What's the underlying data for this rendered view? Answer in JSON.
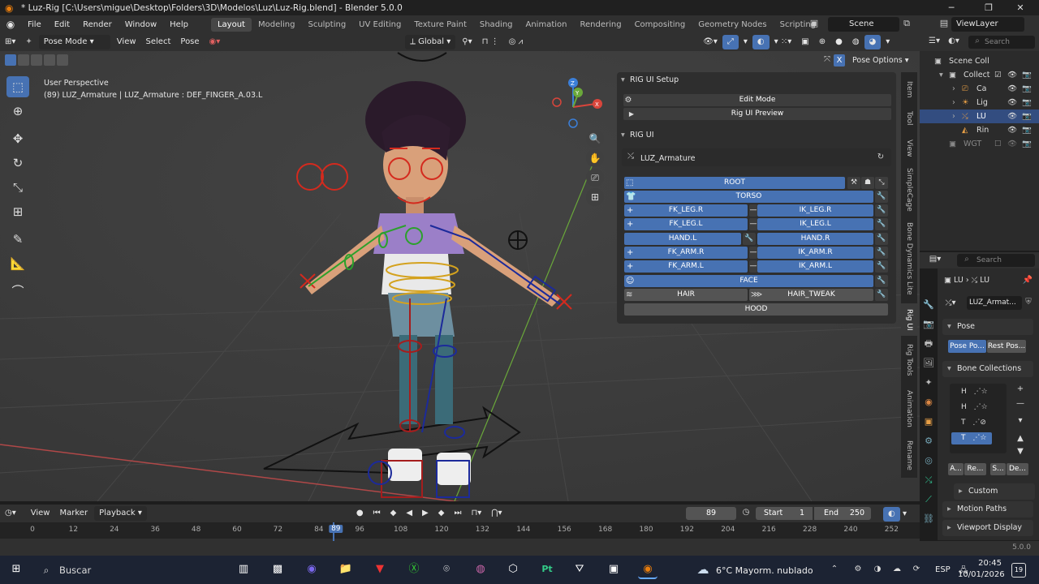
{
  "window": {
    "title": "* Luz-Rig [C:\\Users\\migue\\Desktop\\Folders\\3D\\Modelos\\Luz\\Luz-Rig.blend] - Blender 5.0.0",
    "minimize": "─",
    "maximize": "❐",
    "close": "✕"
  },
  "menu": {
    "items": [
      "File",
      "Edit",
      "Render",
      "Window",
      "Help"
    ]
  },
  "workspaces": [
    "Layout",
    "Modeling",
    "Sculpting",
    "UV Editing",
    "Texture Paint",
    "Shading",
    "Animation",
    "Rendering",
    "Compositing",
    "Geometry Nodes",
    "Scripting"
  ],
  "scene": {
    "label": "Scene",
    "view_layer": "ViewLayer"
  },
  "viewport_header": {
    "mode": "Pose Mode",
    "menus": [
      "View",
      "Select",
      "Pose"
    ],
    "orientation": "Global",
    "pose_options": "Pose Options"
  },
  "viewport": {
    "perspective": "User Perspective",
    "info": "(89) LUZ_Armature | LUZ_Armature : DEF_FINGER_A.03.L"
  },
  "gizmo": {
    "z": "Z",
    "y": "Y",
    "x": "X"
  },
  "rig_setup": {
    "title": "RIG UI Setup",
    "edit_mode": "Edit Mode",
    "preview": "Rig UI Preview"
  },
  "rig_ui": {
    "title": "RIG UI",
    "armature": "LUZ_Armature",
    "root": "ROOT",
    "torso": "TORSO",
    "fk_leg_r": "FK_LEG.R",
    "ik_leg_r": "IK_LEG.R",
    "fk_leg_l": "FK_LEG.L",
    "ik_leg_l": "IK_LEG.L",
    "hand_l": "HAND.L",
    "hand_r": "HAND.R",
    "fk_arm_r": "FK_ARM.R",
    "ik_arm_r": "IK_ARM.R",
    "fk_arm_l": "FK_ARM.L",
    "ik_arm_l": "IK_ARM.L",
    "face": "FACE",
    "hair": "HAIR",
    "hair_tweak": "HAIR_TWEAK",
    "hood": "HOOD"
  },
  "sidebar_tabs": [
    "Item",
    "Tool",
    "View",
    "SimpleCage",
    "Bone Dynamics Lite",
    "Rig UI",
    "Rig Tools",
    "Animation",
    "Rename"
  ],
  "outliner": {
    "search": "Search",
    "rows": [
      {
        "label": "Scene Coll"
      },
      {
        "label": "Collect"
      },
      {
        "label": "Ca"
      },
      {
        "label": "Lig"
      },
      {
        "label": "LU"
      },
      {
        "label": "Rin"
      },
      {
        "label": "WGT"
      }
    ]
  },
  "properties": {
    "search": "Search",
    "breadcrumb_a": "LU",
    "breadcrumb_b": "LU",
    "armature_name": "LUZ_Armat...",
    "pose_section": "Pose",
    "pose_position": "Pose Po...",
    "rest_position": "Rest Pos...",
    "bone_collections": "Bone Collections",
    "collections": [
      "H",
      "H",
      "T",
      "T"
    ],
    "btn_a": "A...",
    "btn_re": "Re...",
    "btn_s": "S...",
    "btn_de": "De...",
    "custom_props": "Custom Properties",
    "motion_paths": "Motion Paths",
    "viewport_display": "Viewport Display"
  },
  "timeline": {
    "menus": [
      "View",
      "Marker",
      "Playback"
    ],
    "current_frame": "89",
    "start_label": "Start",
    "start": "1",
    "end_label": "End",
    "end": "250",
    "ticks": [
      "0",
      "12",
      "24",
      "36",
      "48",
      "60",
      "72",
      "84",
      "89",
      "96",
      "108",
      "120",
      "132",
      "144",
      "156",
      "168",
      "180",
      "192",
      "204",
      "216",
      "228",
      "240",
      "252"
    ]
  },
  "status": {
    "version": "5.0.0"
  },
  "taskbar": {
    "search": "Buscar",
    "weather": "6°C  Mayorm. nublado",
    "lang": "ESP",
    "time": "20:45",
    "date": "10/01/2026",
    "notif": "19"
  },
  "colors": {
    "accent": "#4772b3",
    "blender_orange": "#e87d0d",
    "viewport": "#3a3a3a",
    "panel": "#2e2e2e"
  }
}
